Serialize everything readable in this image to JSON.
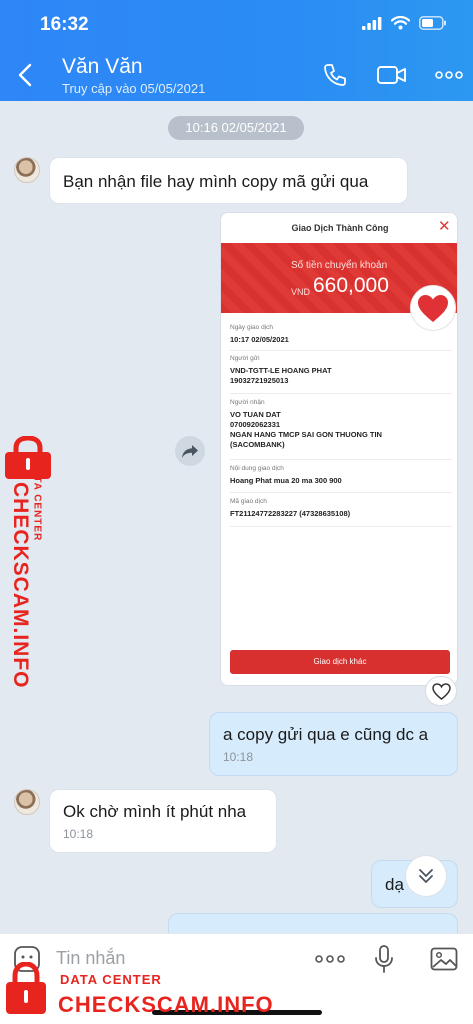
{
  "status_bar": {
    "time": "16:32"
  },
  "header": {
    "contact_name": "Văn Văn",
    "last_seen": "Truy cập vào 05/05/2021",
    "icons": [
      "back-icon",
      "phone-icon",
      "video-call-icon",
      "more-icon"
    ]
  },
  "chat": {
    "date_chip": "10:16 02/05/2021",
    "messages": [
      {
        "from": "them",
        "text": "Bạn nhận file hay mình copy mã gửi qua"
      },
      {
        "from": "me",
        "text": "a copy gửi qua e cũng dc a",
        "time": "10:18"
      },
      {
        "from": "them",
        "text": "Ok chờ mình ít phút nha",
        "time": "10:18"
      },
      {
        "from": "me",
        "text": "dạ"
      }
    ]
  },
  "receipt": {
    "title": "Giao Dịch Thành Công",
    "amount_label": "Số tiền chuyển khoản",
    "currency": "VND",
    "amount": "660,000",
    "fields": [
      {
        "label": "Ngày giao dịch",
        "value": "10:17 02/05/2021"
      },
      {
        "label": "Người gửi",
        "value": "VND-TGTT-LE HOANG PHAT\n19032721925013"
      },
      {
        "label": "Người nhận",
        "value": "VO TUAN DAT\n070092062331\nNGAN HANG TMCP SAI GON THUONG TIN\n(SACOMBANK)"
      },
      {
        "label": "Nội dung giao dịch",
        "value": "Hoang Phat mua 20 ma 300 900"
      },
      {
        "label": "Mã giao dịch",
        "value": "FT21124772283227 (47328635108)"
      }
    ],
    "button": "Giao dịch khác"
  },
  "composer": {
    "placeholder": "Tin nhắn"
  },
  "watermark": {
    "small": "DATA CENTER",
    "big": "CHECKSCAM.INFO"
  },
  "colors": {
    "header": "#2f86f6",
    "accent_red": "#d7302f",
    "my_bubble": "#d6ebfc"
  }
}
